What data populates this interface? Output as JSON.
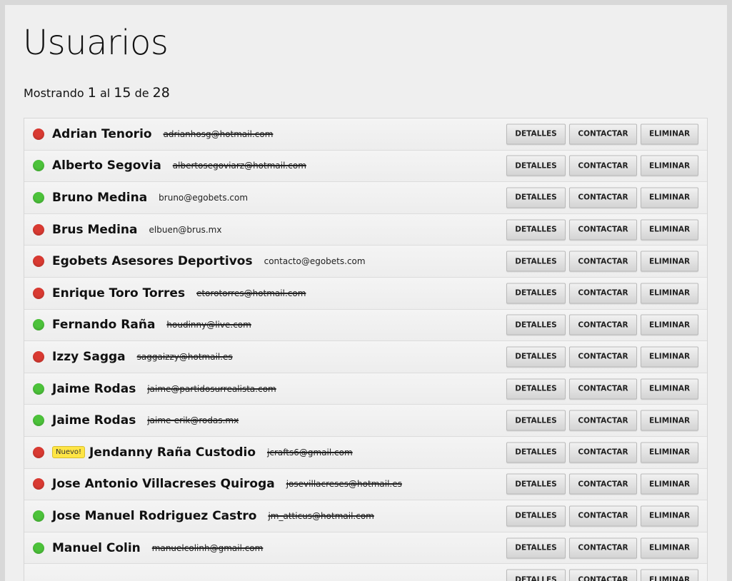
{
  "page": {
    "title": "Usuarios",
    "pagination": {
      "prefix": "Mostrando",
      "from": "1",
      "sep1": "al",
      "to": "15",
      "sep2": "de",
      "total": "28"
    }
  },
  "actions": {
    "details_label": "DETALLES",
    "contact_label": "CONTACTAR",
    "delete_label": "ELIMINAR"
  },
  "colors": {
    "status_active": "#4cc23a",
    "status_inactive": "#d93a32",
    "badge": "#ffe545"
  },
  "users": [
    {
      "name": "Adrian Tenorio",
      "email": "adrianhosg@hotmail.com",
      "status": "red",
      "redacted": true
    },
    {
      "name": "Alberto Segovia",
      "email": "albertosegoviarz@hotmail.com",
      "status": "green",
      "redacted": true
    },
    {
      "name": "Bruno Medina",
      "email": "bruno@egobets.com",
      "status": "green",
      "redacted": false
    },
    {
      "name": "Brus Medina",
      "email": "elbuen@brus.mx",
      "status": "red",
      "redacted": false
    },
    {
      "name": "Egobets Asesores Deportivos",
      "email": "contacto@egobets.com",
      "status": "red",
      "redacted": false
    },
    {
      "name": "Enrique Toro Torres",
      "email": "etorotorres@hotmail.com",
      "status": "red",
      "redacted": true
    },
    {
      "name": "Fernando Raña",
      "email": "houdinny@live.com",
      "status": "green",
      "redacted": true
    },
    {
      "name": "Izzy Sagga",
      "email": "saggaizzy@hotmail.es",
      "status": "red",
      "redacted": true
    },
    {
      "name": "Jaime Rodas",
      "email": "jaime@partidosurrealista.com",
      "status": "green",
      "redacted": true
    },
    {
      "name": "Jaime Rodas",
      "email": "jaime-erik@rodas.mx",
      "status": "green",
      "redacted": true
    },
    {
      "name": "Jendanny Raña Custodio",
      "email": "jcrafts6@gmail.com",
      "status": "red",
      "redacted": true,
      "badge": "Nuevo!"
    },
    {
      "name": "Jose Antonio Villacreses Quiroga",
      "email": "josevillacreses@hotmail.es",
      "status": "red",
      "redacted": true
    },
    {
      "name": "Jose Manuel Rodriguez Castro",
      "email": "jm_atticus@hotmail.com",
      "status": "green",
      "redacted": true
    },
    {
      "name": "Manuel Colin",
      "email": "manuelcolinh@gmail.com",
      "status": "green",
      "redacted": true
    },
    {
      "name": "",
      "email": "",
      "status": "none",
      "redacted": false
    }
  ]
}
